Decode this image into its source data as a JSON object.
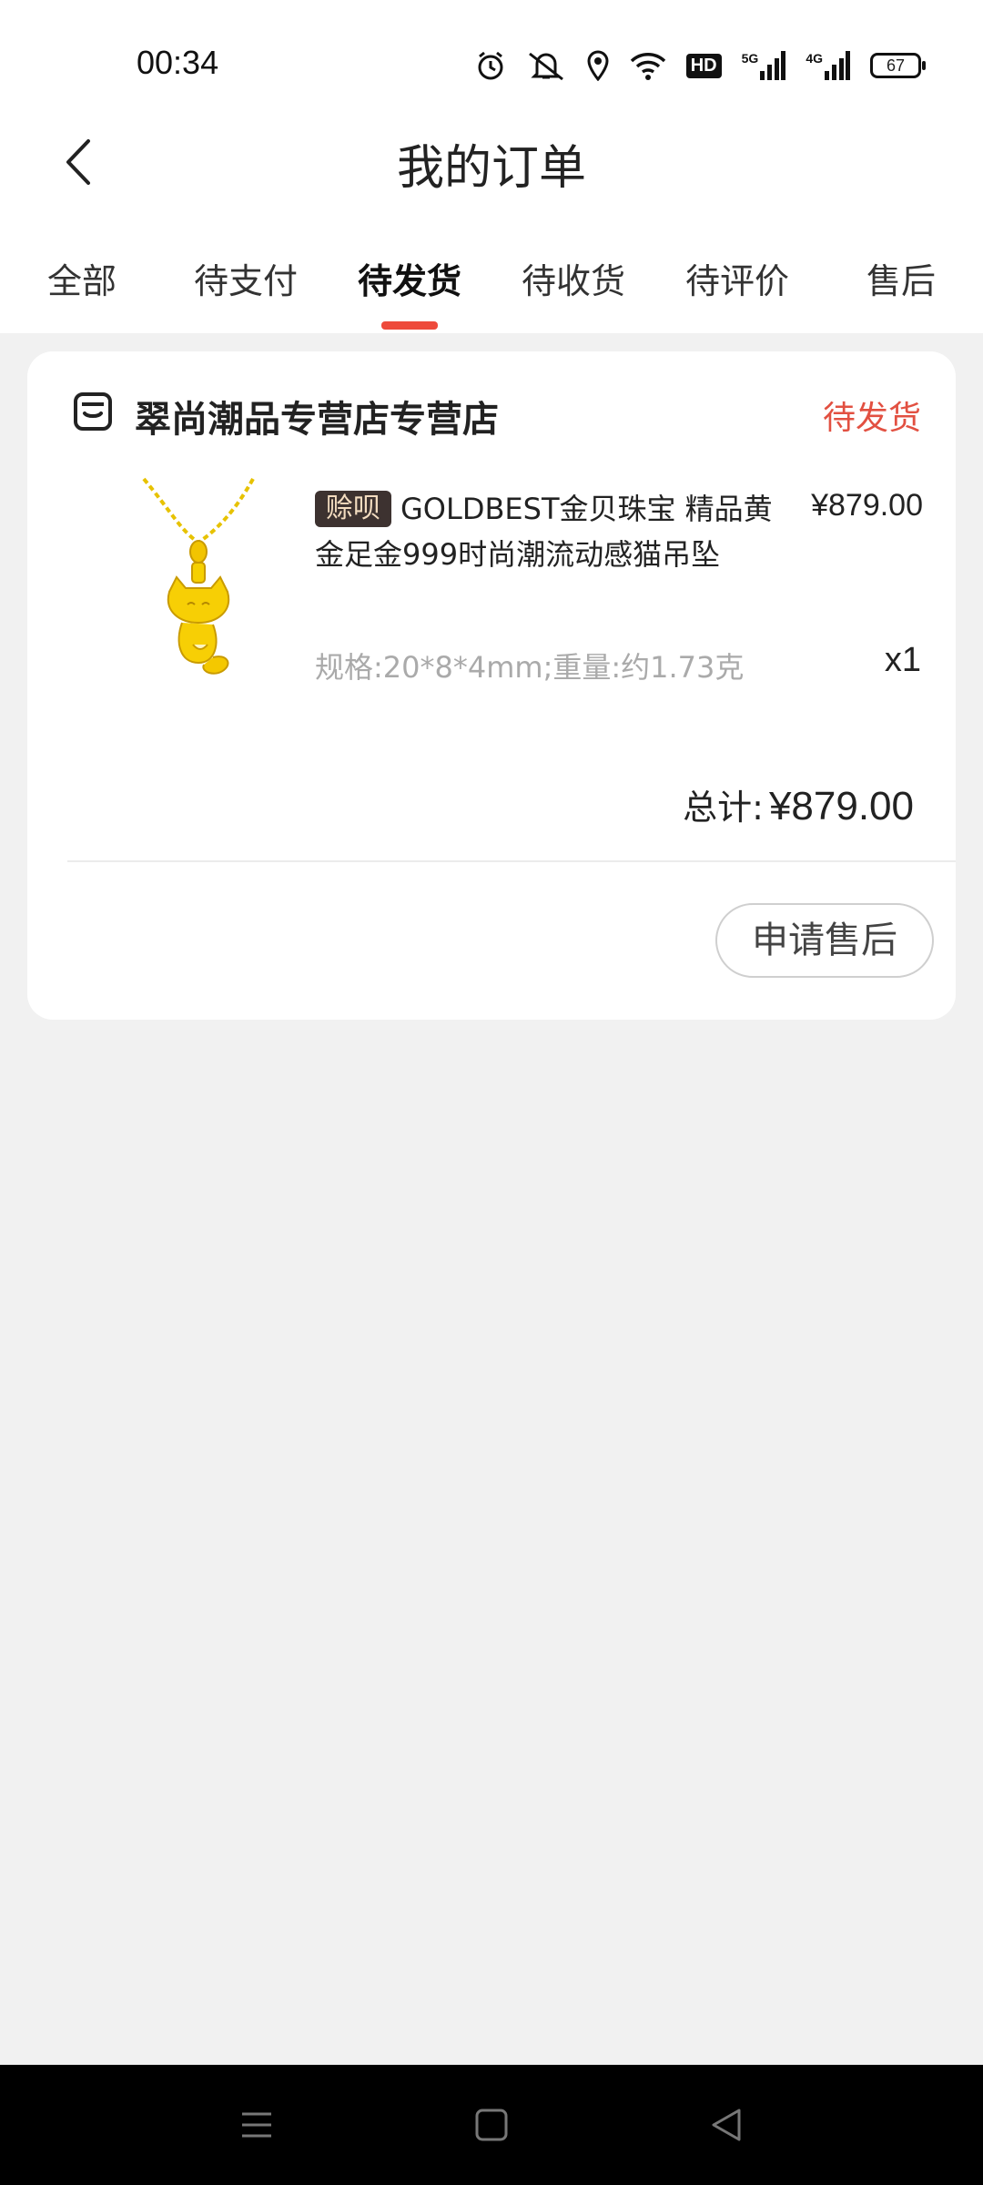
{
  "status_bar": {
    "time": "00:34",
    "icons": [
      "alarm-icon",
      "mute-icon",
      "location-icon",
      "wifi-icon",
      "hd-icon",
      "signal-5g-icon",
      "signal-4g-icon",
      "battery-icon"
    ],
    "hd_label": "HD",
    "net1_label": "5G",
    "net2_label": "4G",
    "battery": "67"
  },
  "header": {
    "title": "我的订单",
    "back_icon": "chevron-left-icon"
  },
  "tabs": [
    {
      "label": "全部"
    },
    {
      "label": "待支付"
    },
    {
      "label": "待发货"
    },
    {
      "label": "待收货"
    },
    {
      "label": "待评价"
    },
    {
      "label": "售后"
    }
  ],
  "active_tab": "待发货",
  "order": {
    "store_icon": "store-icon",
    "store_name": "翠尚潮品专营店专营店",
    "status": "待发货",
    "product": {
      "tag": "赊呗",
      "title": "GOLDBEST金贝珠宝 精品黄金足金999时尚潮流动感猫吊坠",
      "price": "¥879.00",
      "spec": "规格:20*8*4mm;重量:约1.73克",
      "quantity": "x1"
    },
    "total_label": "总计:",
    "total_value": "¥879.00",
    "action_button": "申请售后"
  },
  "colors": {
    "accent": "#ee4a3b",
    "status_text": "#e25041",
    "background": "#f1f1f1",
    "tag_bg": "#3d3230",
    "tag_text": "#f3dcc0"
  },
  "nav_bar": {
    "icons": [
      "menu-icon",
      "home-icon",
      "back-icon"
    ]
  }
}
